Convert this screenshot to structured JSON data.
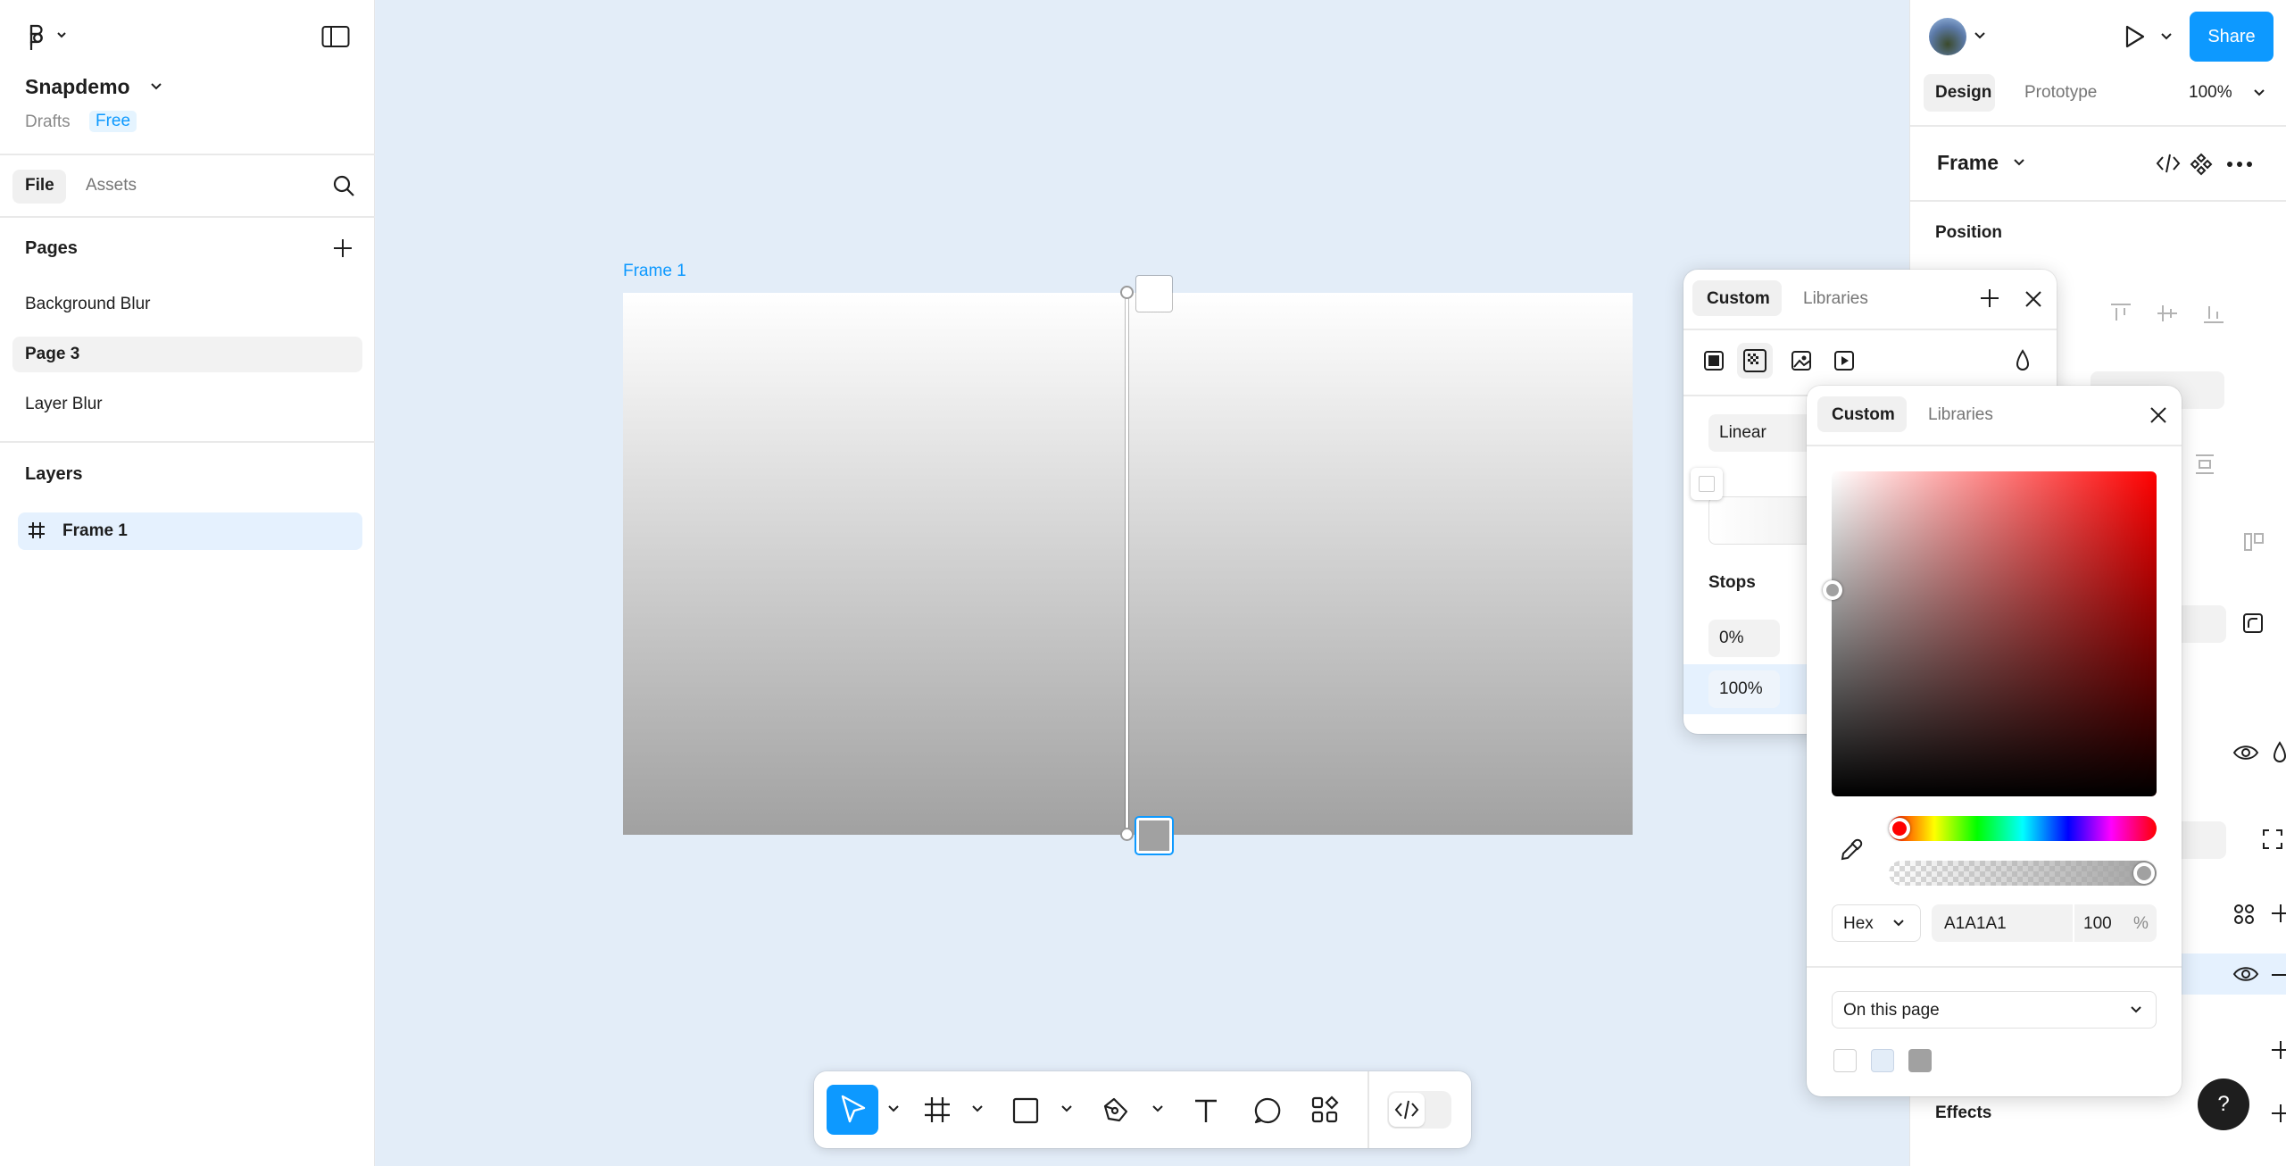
{
  "app": {
    "file_name": "Snapdemo",
    "drafts_label": "Drafts",
    "plan_badge": "Free"
  },
  "left_panel": {
    "tabs": [
      "File",
      "Assets"
    ],
    "pages_heading": "Pages",
    "pages": [
      {
        "label": "Background Blur",
        "selected": false
      },
      {
        "label": "Page 3",
        "selected": true
      },
      {
        "label": "Layer Blur",
        "selected": false
      }
    ],
    "layers_heading": "Layers",
    "layers": [
      {
        "label": "Frame 1",
        "icon": "frame-hash-icon",
        "selected": true
      }
    ]
  },
  "canvas": {
    "frame_label": "Frame 1",
    "gradient": {
      "from": "#FFFFFF",
      "to": "#A1A1A1",
      "direction": "top-to-bottom"
    },
    "background": "#E3EDF8"
  },
  "header_right": {
    "share_label": "Share",
    "tabs": [
      "Design",
      "Prototype"
    ],
    "zoom": "100%"
  },
  "right_panel": {
    "selection_type": "Frame",
    "position_heading": "Position",
    "effects_heading": "Effects"
  },
  "fill_popover": {
    "tabs": [
      "Custom",
      "Libraries"
    ],
    "gradient_type": "Linear",
    "stops_heading": "Stops",
    "stops": [
      "0%",
      "100%"
    ]
  },
  "color_picker": {
    "tabs": [
      "Custom",
      "Libraries"
    ],
    "hue_color": "#FF0000",
    "format": "Hex",
    "hex_value": "A1A1A1",
    "opacity": "100",
    "opacity_unit": "%",
    "swatch_source": "On this page",
    "swatches": [
      "#FFFFFF",
      "#E3EDF8",
      "#A1A1A1"
    ]
  },
  "colors": {
    "accent": "#0D99FF",
    "selection": "#E5F1FE",
    "text_secondary": "#757575"
  },
  "toolbar": {
    "tools": [
      "move-tool",
      "frame-tool",
      "shape-tool",
      "pen-tool",
      "text-tool",
      "comment-tool",
      "actions-tool",
      "dev-mode-toggle"
    ]
  },
  "help_label": "?"
}
